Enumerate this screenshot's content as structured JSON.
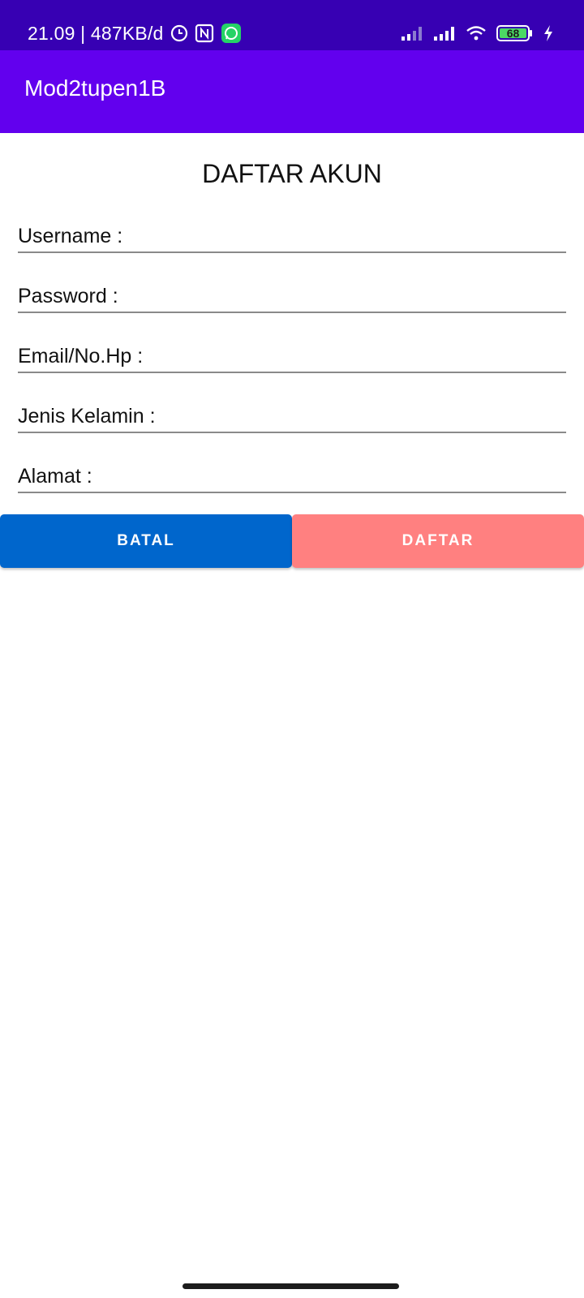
{
  "status_bar": {
    "time_speed": "21.09 | 487KB/d",
    "battery_level": "68",
    "icons": [
      "alarm-icon",
      "nfc-icon",
      "whatsapp-icon",
      "signal-icon",
      "signal-icon",
      "wifi-icon",
      "battery-icon",
      "charging-icon"
    ],
    "background_color": "#3700b3"
  },
  "app_bar": {
    "title": "Mod2tupen1B",
    "background_color": "#6200ee"
  },
  "form": {
    "title": "DAFTAR AKUN",
    "fields": [
      {
        "placeholder": "Username :"
      },
      {
        "placeholder": "Password :"
      },
      {
        "placeholder": "Email/No.Hp :"
      },
      {
        "placeholder": "Jenis Kelamin :"
      },
      {
        "placeholder": "Alamat :"
      }
    ]
  },
  "buttons": {
    "cancel_label": "BATAL",
    "submit_label": "DAFTAR",
    "cancel_color": "#0066cc",
    "submit_color": "#ff8080"
  }
}
